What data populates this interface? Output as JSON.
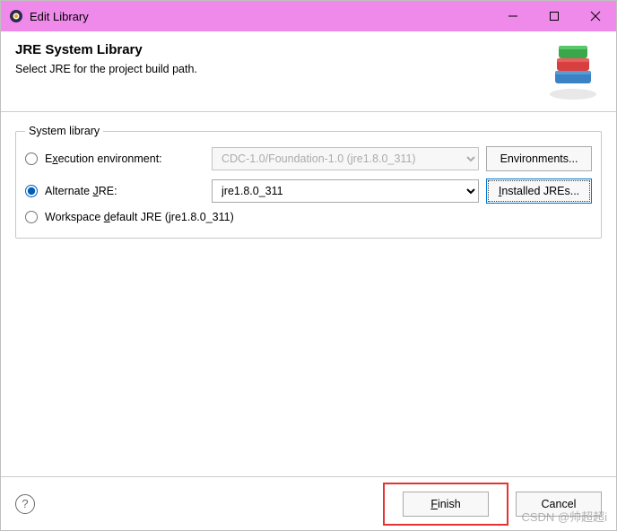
{
  "window": {
    "title": "Edit Library"
  },
  "header": {
    "title": "JRE System Library",
    "description": "Select JRE for the project build path."
  },
  "group": {
    "legend": "System library",
    "execution_env": {
      "label_pre": "E",
      "label_mn": "x",
      "label_post": "ecution environment:",
      "value": "CDC-1.0/Foundation-1.0 (jre1.8.0_311)",
      "button": "Environments..."
    },
    "alternate": {
      "label_pre": "Alternate ",
      "label_mn": "J",
      "label_post": "RE:",
      "value": "jre1.8.0_311",
      "button_mn": "I",
      "button_post": "nstalled JREs..."
    },
    "workspace": {
      "label_pre": "Workspace ",
      "label_mn": "d",
      "label_post": "efault JRE (jre1.8.0_311)"
    }
  },
  "footer": {
    "finish_mn": "F",
    "finish_post": "inish",
    "cancel": "Cancel"
  },
  "watermark": "CSDN @帅超超i"
}
